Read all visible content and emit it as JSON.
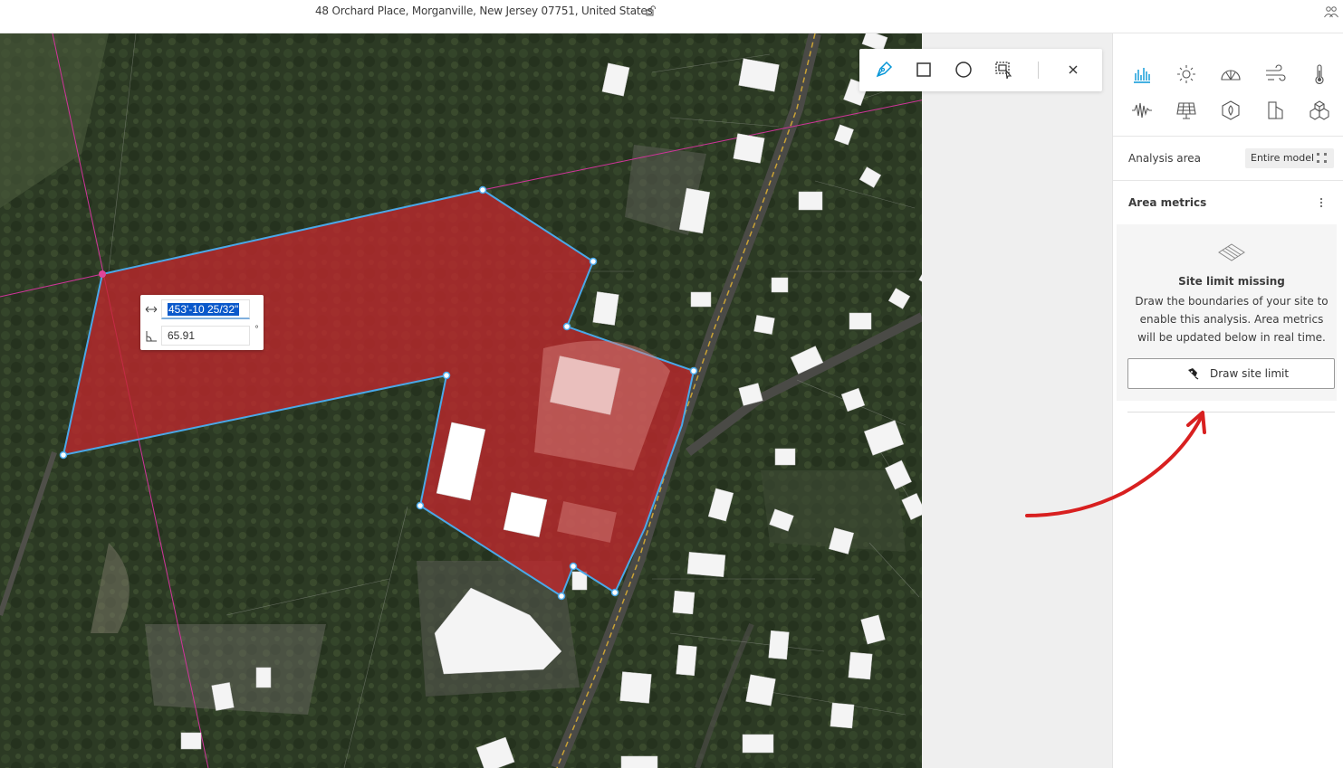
{
  "header": {
    "address": "48 Orchard Place, Morganville, New Jersey 07751, United States",
    "lock_icon": "unlock-icon",
    "users_icon": "users-icon"
  },
  "toolbar": {
    "tools": [
      "pen-draw-icon",
      "rectangle-icon",
      "circle-icon",
      "select-area-icon"
    ],
    "close_icon": "close-icon",
    "active_color": "#0696d7"
  },
  "dimension_input": {
    "length_value": "453'-10 25/32\"",
    "angle_value": "65.91",
    "angle_unit": "°"
  },
  "panel": {
    "analysis_icons": [
      "bar-chart-icon",
      "sun-icon",
      "daylight-arc-icon",
      "wind-icon",
      "thermometer-icon",
      "noise-wave-icon",
      "solar-panel-icon",
      "energy-icon",
      "shadow-icon",
      "volume-cubes-icon"
    ],
    "analysis_area_label": "Analysis area",
    "analysis_area_value": "Entire model",
    "area_metrics_label": "Area metrics",
    "empty_state": {
      "title": "Site limit missing",
      "text": "Draw the boundaries of your site to enable this analysis. Area metrics will be updated below in real time.",
      "button_label": "Draw site limit"
    }
  },
  "colors": {
    "site_fill": "#c0282d",
    "boundary_line": "#4aa8e8",
    "annotation_arrow": "#d82020"
  }
}
